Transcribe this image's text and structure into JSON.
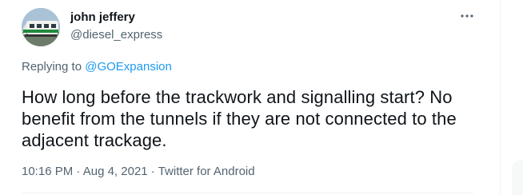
{
  "tweet": {
    "author": {
      "name": "john jeffery",
      "handle": "@diesel_express"
    },
    "replying_prefix": "Replying to ",
    "replying_to": "@GOExpansion",
    "text": "How long before the trackwork and signalling start? No benefit from the tunnels if they are not connected to the adjacent trackage.",
    "time": "10:16 PM",
    "separator": " · ",
    "date": "Aug 4, 2021",
    "source": "Twitter for Android",
    "more_icon": "more-horizontal-icon"
  },
  "colors": {
    "text": "#0f1419",
    "secondary": "#536471",
    "accent": "#1d9bf0",
    "avatar_train_green": "#1f8a3a"
  }
}
